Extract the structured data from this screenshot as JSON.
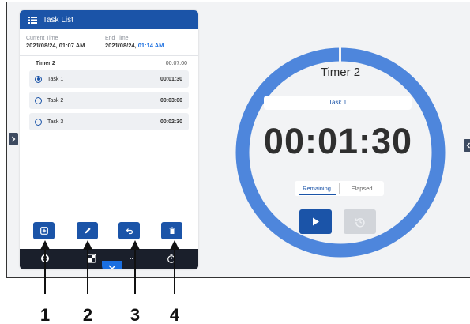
{
  "panel": {
    "title": "Task List",
    "current_time_label": "Current Time",
    "current_time_value": "2021/08/24, 01:07 AM",
    "end_time_label": "End Time",
    "end_time_date": "2021/08/24, ",
    "end_time_clock": "01:14 AM",
    "timer_name": "Timer 2",
    "timer_total": "00:07:00",
    "tasks": [
      {
        "name": "Task 1",
        "duration": "00:01:30",
        "selected": true
      },
      {
        "name": "Task 2",
        "duration": "00:03:00",
        "selected": false
      },
      {
        "name": "Task 3",
        "duration": "00:02:30",
        "selected": false
      }
    ],
    "action_icons": [
      "add-icon",
      "edit-icon",
      "undo-icon",
      "delete-icon"
    ],
    "bottom_icons": [
      "tools-icon",
      "widget-icon",
      "more-icon",
      "timer-icon"
    ]
  },
  "timer": {
    "title": "Timer 2",
    "current_task": "Task 1",
    "time": "00:01:30",
    "mode_remaining": "Remaining",
    "mode_elapsed": "Elapsed",
    "active_mode": "Remaining"
  },
  "callouts": [
    "1",
    "2",
    "3",
    "4"
  ],
  "colors": {
    "primary": "#1b54a8",
    "ring": "#4e86dc",
    "accent": "#1b6fe0",
    "bar": "#1a1f2b"
  }
}
